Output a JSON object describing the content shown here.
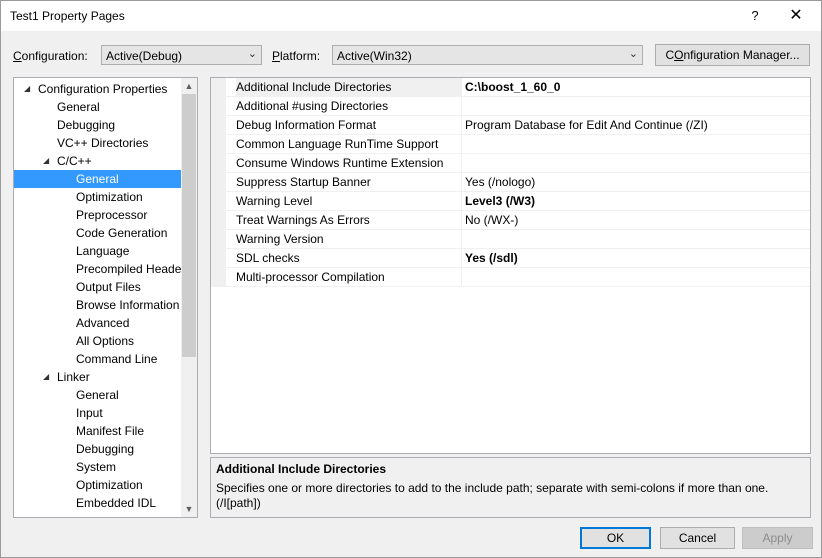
{
  "window": {
    "title": "Test1 Property Pages",
    "help_glyph": "?",
    "close_glyph": "✕"
  },
  "toolbar": {
    "configuration_label_u": "C",
    "configuration_label_rest": "onfiguration:",
    "configuration_value": "Active(Debug)",
    "platform_label_u": "P",
    "platform_label_rest": "latform:",
    "platform_value": "Active(Win32)",
    "config_manager_u": "O",
    "config_manager_pre": "C",
    "config_manager_rest": "nfiguration Manager..."
  },
  "tree": {
    "items": [
      {
        "label": "Configuration Properties",
        "expander": "◢"
      },
      {
        "label": "General"
      },
      {
        "label": "Debugging"
      },
      {
        "label": "VC++ Directories"
      },
      {
        "label": "C/C++",
        "expander": "◢"
      },
      {
        "label": "General",
        "selected": true
      },
      {
        "label": "Optimization"
      },
      {
        "label": "Preprocessor"
      },
      {
        "label": "Code Generation"
      },
      {
        "label": "Language"
      },
      {
        "label": "Precompiled Heade"
      },
      {
        "label": "Output Files"
      },
      {
        "label": "Browse Information"
      },
      {
        "label": "Advanced"
      },
      {
        "label": "All Options"
      },
      {
        "label": "Command Line"
      },
      {
        "label": "Linker",
        "expander": "◢"
      },
      {
        "label": "General"
      },
      {
        "label": "Input"
      },
      {
        "label": "Manifest File"
      },
      {
        "label": "Debugging"
      },
      {
        "label": "System"
      },
      {
        "label": "Optimization"
      },
      {
        "label": "Embedded IDL"
      }
    ],
    "scroll_up_glyph": "▲",
    "scroll_down_glyph": "▼"
  },
  "properties": [
    {
      "name": "Additional Include Directories",
      "value": "C:\\boost_1_60_0",
      "bold": true
    },
    {
      "name": "Additional #using Directories",
      "value": ""
    },
    {
      "name": "Debug Information Format",
      "value": "Program Database for Edit And Continue (/ZI)"
    },
    {
      "name": "Common Language RunTime Support",
      "value": ""
    },
    {
      "name": "Consume Windows Runtime Extension",
      "value": ""
    },
    {
      "name": "Suppress Startup Banner",
      "value": "Yes (/nologo)"
    },
    {
      "name": "Warning Level",
      "value": "Level3 (/W3)",
      "bold": true
    },
    {
      "name": "Treat Warnings As Errors",
      "value": "No (/WX-)"
    },
    {
      "name": "Warning Version",
      "value": ""
    },
    {
      "name": "SDL checks",
      "value": "Yes (/sdl)",
      "bold": true
    },
    {
      "name": "Multi-processor Compilation",
      "value": ""
    }
  ],
  "description": {
    "title": "Additional Include Directories",
    "text": "Specifies one or more directories to add to the include path; separate with semi-colons if more than one. (/I[path])"
  },
  "buttons": {
    "ok": "OK",
    "cancel": "Cancel",
    "apply": "Apply",
    "combo_arrow": "⌄"
  }
}
